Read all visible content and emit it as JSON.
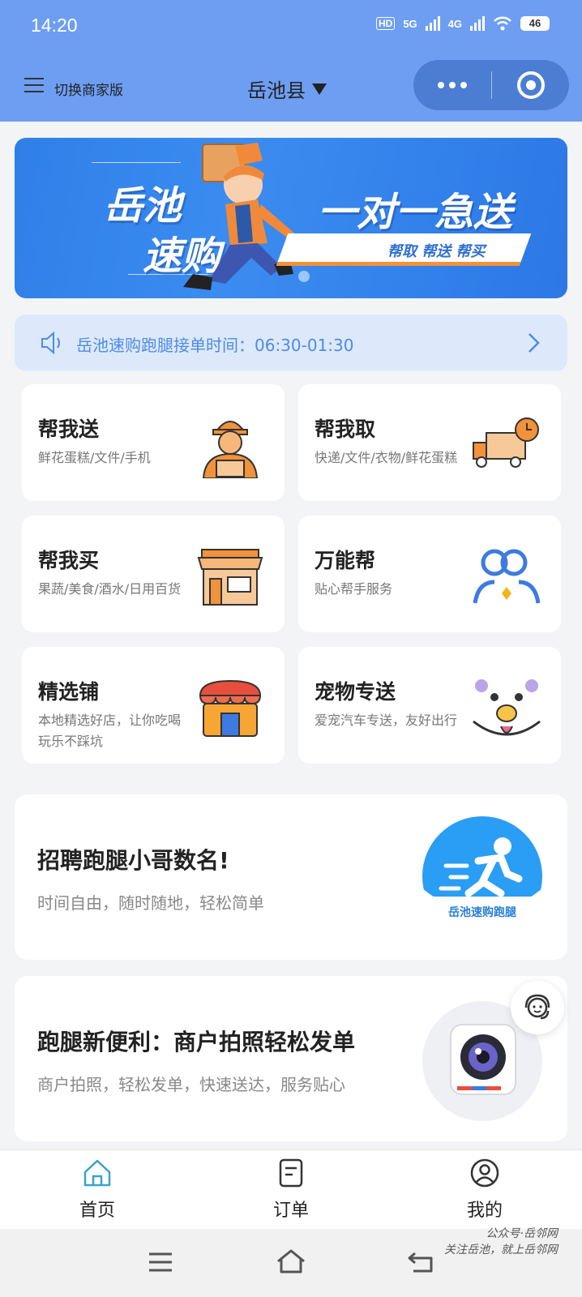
{
  "status_bar": {
    "time": "14:20",
    "hd": "HD",
    "net1": "5G",
    "net2": "4G",
    "battery": "46"
  },
  "header": {
    "merchant_switch": "切换商家版",
    "location": "岳池县"
  },
  "banner": {
    "title_line1": "岳池",
    "title_line2": "速购",
    "slogan": "一对一急送",
    "tags": "帮取 帮送 帮买"
  },
  "notice": {
    "text": "岳池速购跑腿接单时间：06:30-01:30"
  },
  "services": [
    {
      "title": "帮我送",
      "desc": "鲜花蛋糕/文件/手机",
      "icon": "courier-icon"
    },
    {
      "title": "帮我取",
      "desc": "快递/文件/衣物/鲜花蛋糕",
      "icon": "delivery-truck-icon"
    },
    {
      "title": "帮我买",
      "desc": "果蔬/美食/酒水/日用百货",
      "icon": "shop-icon"
    },
    {
      "title": "万能帮",
      "desc": "贴心帮手服务",
      "icon": "people-icon"
    },
    {
      "title": "精选铺",
      "desc": "本地精选好店，让你吃喝玩乐不踩坑",
      "icon": "store-icon"
    },
    {
      "title": "宠物专送",
      "desc": "爱宠汽车专送，友好出行",
      "icon": "dog-face-icon"
    }
  ],
  "promos": [
    {
      "title": "招聘跑腿小哥数名!",
      "desc": "时间自由，随时随地，轻松简单",
      "badge": "岳池速购跑腿"
    },
    {
      "title": "跑腿新便利：商户拍照轻松发单",
      "desc": "商户拍照，轻松发单，快速送达，服务贴心"
    }
  ],
  "tabs": [
    {
      "label": "首页",
      "icon": "home-icon",
      "active": true
    },
    {
      "label": "订单",
      "icon": "order-icon",
      "active": false
    },
    {
      "label": "我的",
      "icon": "profile-icon",
      "active": false
    }
  ],
  "watermark": {
    "line1": "公众号·岳邻网",
    "line2": "关注岳池，就上岳邻网"
  },
  "colors": {
    "header_bg": "#6e9ef2",
    "accent": "#4d8be6",
    "orange": "#f2923a"
  }
}
